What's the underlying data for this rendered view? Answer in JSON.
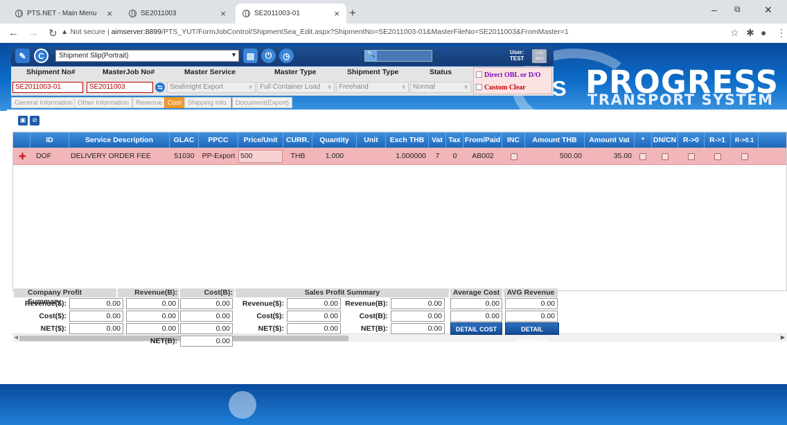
{
  "browser": {
    "tabs": [
      {
        "title": "PTS.NET - Main Menu"
      },
      {
        "title": "SE2011003"
      },
      {
        "title": "SE2011003-01"
      }
    ],
    "url_prefix": "Not secure",
    "url_host": "aimserver:8899",
    "url_path": "/PTS_YUT/FormJobControl/ShipmentSea_Edit.aspx?ShipmentNo=SE2011003-01&MasterFileNo=SE2011003&FromMaster=1"
  },
  "toolbar": {
    "report_select": "Shipment Slip(Portrait)",
    "user_label": "User:",
    "user_name": "TEST",
    "log_label": "LOG INFO"
  },
  "brand": {
    "line1": "PROGRESS",
    "line2": "TRANSPORT SYSTEM"
  },
  "header": {
    "labels": {
      "shipment_no": "Shipment No#",
      "masterjob_no": "MasterJob No#",
      "master_service": "Master Service",
      "master_type": "Master Type",
      "shipment_type": "Shipment Type",
      "status": "Status"
    },
    "values": {
      "shipment_no": "SE2011003-01",
      "masterjob_no": "SE2011003",
      "master_service": "Seafreight Export",
      "master_type": "Full Container Load",
      "shipment_type": "Freehand",
      "status": "Normal"
    },
    "options": {
      "direct_obl": "Direct OBL or D/O",
      "custom_clear": "Custom Clear"
    }
  },
  "subtabs": [
    "General Information",
    "Other Information",
    "Revenue",
    "Cost",
    "Shipping Info.",
    "Document(Export)"
  ],
  "active_subtab": "Cost",
  "grid": {
    "columns": [
      "ID",
      "Service Description",
      "GLAC",
      "PPCC",
      "Price/Unit",
      "CURR.",
      "Quantity",
      "Unit",
      "Exch THB",
      "Vat",
      "Tax",
      "From/Paid",
      "INC",
      "Amount THB",
      "Amount Vat",
      "*",
      "DN/CN",
      "R->0",
      "R->1",
      "R->0.1"
    ],
    "rows": [
      {
        "id": "DOF",
        "description": "DELIVERY ORDER FEE",
        "glac": "51030",
        "ppcc": "PP-Export",
        "price": "500",
        "curr": "THB",
        "quantity": "1.000",
        "unit": "",
        "exch": "1.000000",
        "vat": "7",
        "tax": "0",
        "from_paid": "AB002",
        "amount_thb": "500.00",
        "amount_vat": "35.00"
      }
    ]
  },
  "summary": {
    "company_title": "Company Profit Summary",
    "revenue_b": "Revenue(B):",
    "cost_b": "Cost(B):",
    "sales_title": "Sales Profit Summary",
    "avg_cost": "Average Cost",
    "avg_revenue": "AVG Revenue",
    "labels": {
      "rev_s": "Revenue($):",
      "cost_s": "Cost($):",
      "net_s": "NET($):",
      "rev_b": "Revenue(B):",
      "cost_b2": "Cost(B):",
      "net_b": "NET(B):"
    },
    "zero": "0.00",
    "detail_cost": "DETAIL COST",
    "detail_revenue": "DETAIL REVENUE"
  }
}
